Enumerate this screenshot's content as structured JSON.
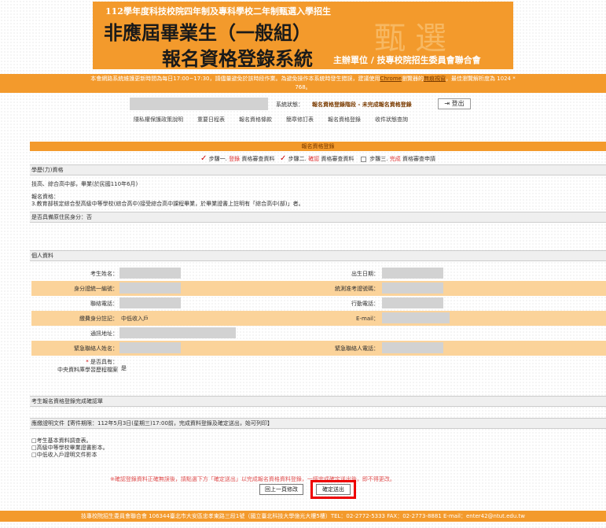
{
  "banner": {
    "subtitle": "112學年度科技校院四年制及專科學校二年制甄選入學招生",
    "title_line1": "非應屆畢業生（一般組）",
    "title_line2": "報名資格登錄系統",
    "organizer": "主辦單位 / 技專校院招生委員會聯合會",
    "deco": "甄選"
  },
  "notice": {
    "line1_prefix": "本會網路系統維護更新時間為每日17:00~17:30，請儘量避免於該時段作業。為避免操作本系統時發生錯誤，建議使用",
    "chrome": "Chrome",
    "browser": "瀏覽器的",
    "privacy_mode": "無痕視窗",
    "line1_suffix": "，最佳瀏覽解析度為 1024 *",
    "line2": "768。"
  },
  "status": {
    "label": "系統狀態：",
    "value": "報名資格登錄階段 - 未完成報名資格登錄",
    "logout": "登出"
  },
  "menu": [
    "隱私權保護政策說明",
    "重要日程表",
    "報名資格條款",
    "簡章修訂表",
    "報名資格登錄",
    "收件狀態查詢"
  ],
  "main": {
    "header": "報名資格登錄",
    "steps": {
      "step1_prefix": "步驟一.",
      "step1_hl": "登錄",
      "step1_suffix": "資格審查資料",
      "step2_prefix": "步驟二.",
      "step2_hl": "確認",
      "step2_suffix": "資格審查資料",
      "step3_prefix": "步驟三.",
      "step3_hl": "完成",
      "step3_suffix": "資格審查申請"
    },
    "education_title": "學歷(力)資格",
    "education_value": "技高、綜合高中部，畢業(於民國110年6月)",
    "qualification_label": "報名資格：",
    "qualification_value": "3.教育部核定綜合型高級中等學校(綜合高中)接受綜合高中課程畢業，於畢業證書上註明有「綜合高中(部)」者。",
    "indigenous": "是否具備原住民身分：否",
    "personal_title": "個人資料",
    "fields": {
      "name": "考生姓名：",
      "birthday": "出生日期：",
      "id_number": "身分證統一編號：",
      "exam_number": "統測准考證號碼：",
      "phone": "聯絡電話：",
      "mobile": "行動電話：",
      "fee_status": "繳費身分註記：",
      "fee_value": "中低收入戶",
      "email": "E-mail：",
      "address": "通訊地址：",
      "emergency_name": "緊急聯絡人姓名：",
      "emergency_phone": "緊急聯絡人電話：",
      "authorize_label_a": "是否具有：",
      "authorize_label_b": "中央資料庫學習歷程檔案",
      "authorize_value": "是",
      "star": "*"
    },
    "confirm_title": "考生報名資格登錄完成確認單",
    "docs_title": "應繳證明文件【寄件期限：112年5月3日(星期三)17:00前，完成資料登錄及確定送出，始可列印】",
    "docs": [
      "□考生基本資料調查表。",
      "□高級中等學校畢業證書影本。",
      "□中低收入戶證明文件影本"
    ],
    "warning": "※確認登錄資料正確無誤後，請點選下方「確定送出」以完成報名資格資料登錄，一經完成確定送出後，即不得更改。",
    "back_button": "回上一頁修改",
    "confirm_button": "確定送出"
  },
  "footer": "技專校院招生委員會聯合會 106344臺北市大安區忠孝東路三段1號（國立臺北科技大學億光大樓5樓）TEL：02-2772-5333 FAX：02-2773-8881 E-mail：enter42@ntut.edu.tw"
}
